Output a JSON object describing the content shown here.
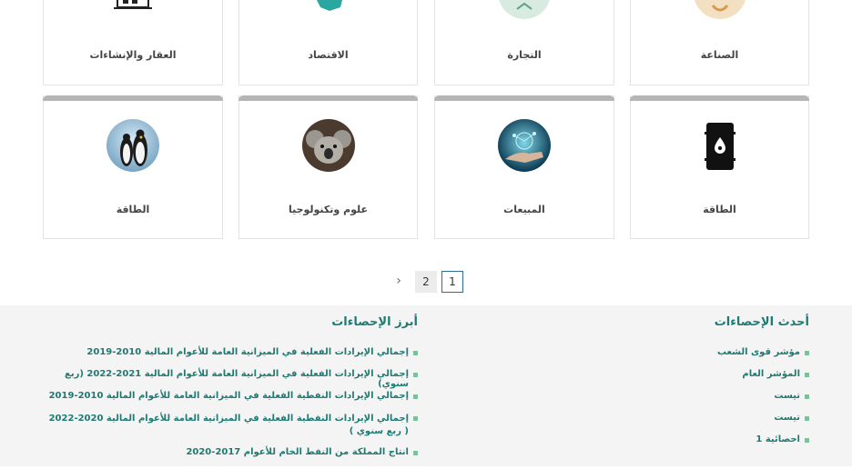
{
  "top_cards": [
    {
      "label": "العقار والإنشاءات"
    },
    {
      "label": "الاقتصاد"
    },
    {
      "label": "التجارة"
    },
    {
      "label": "الصناعة"
    }
  ],
  "cards": [
    {
      "label": "الطاقة",
      "image": "penguins-photo"
    },
    {
      "label": "علوم وتكنولوجيا",
      "image": "koala-photo"
    },
    {
      "label": "المبيعات",
      "image": "network-hand-photo"
    },
    {
      "label": "الطاقة",
      "image": "oil-barrel-icon"
    }
  ],
  "pagination": {
    "pages": [
      "1",
      "2"
    ],
    "active": "1",
    "next_arrow": "›"
  },
  "footer": {
    "latest_title": "أحدث الإحصاءات",
    "latest_items": [
      "مؤشر قوى الشعب",
      "المؤشر العام",
      "تيست",
      "تيست",
      "احصائية 1"
    ],
    "top_title": "أبرز الإحصاءات",
    "top_items": [
      "إجمالي الإيرادات الفعلية في الميزانية العامة للأعوام المالية 2010-2019",
      "إجمالي الإيرادات الفعلية في الميزانية العامة للأعوام المالية 2021-2022 (ربع سنوي)",
      "إجمالي الإيرادات النفطية الفعلية في الميزانية العامة للأعوام المالية 2010-2019",
      "إجمالي الإيرادات النفطية الفعلية في الميزانية العامة للأعوام المالية 2020-2022 ( ربع سنوي )",
      "انتاج المملكة من النفط الخام للأعوام 2017-2020"
    ]
  },
  "colors": {
    "accent": "#1e7a73",
    "bullet": "#7fbf9a",
    "card_bar": "#b5b5b5"
  }
}
